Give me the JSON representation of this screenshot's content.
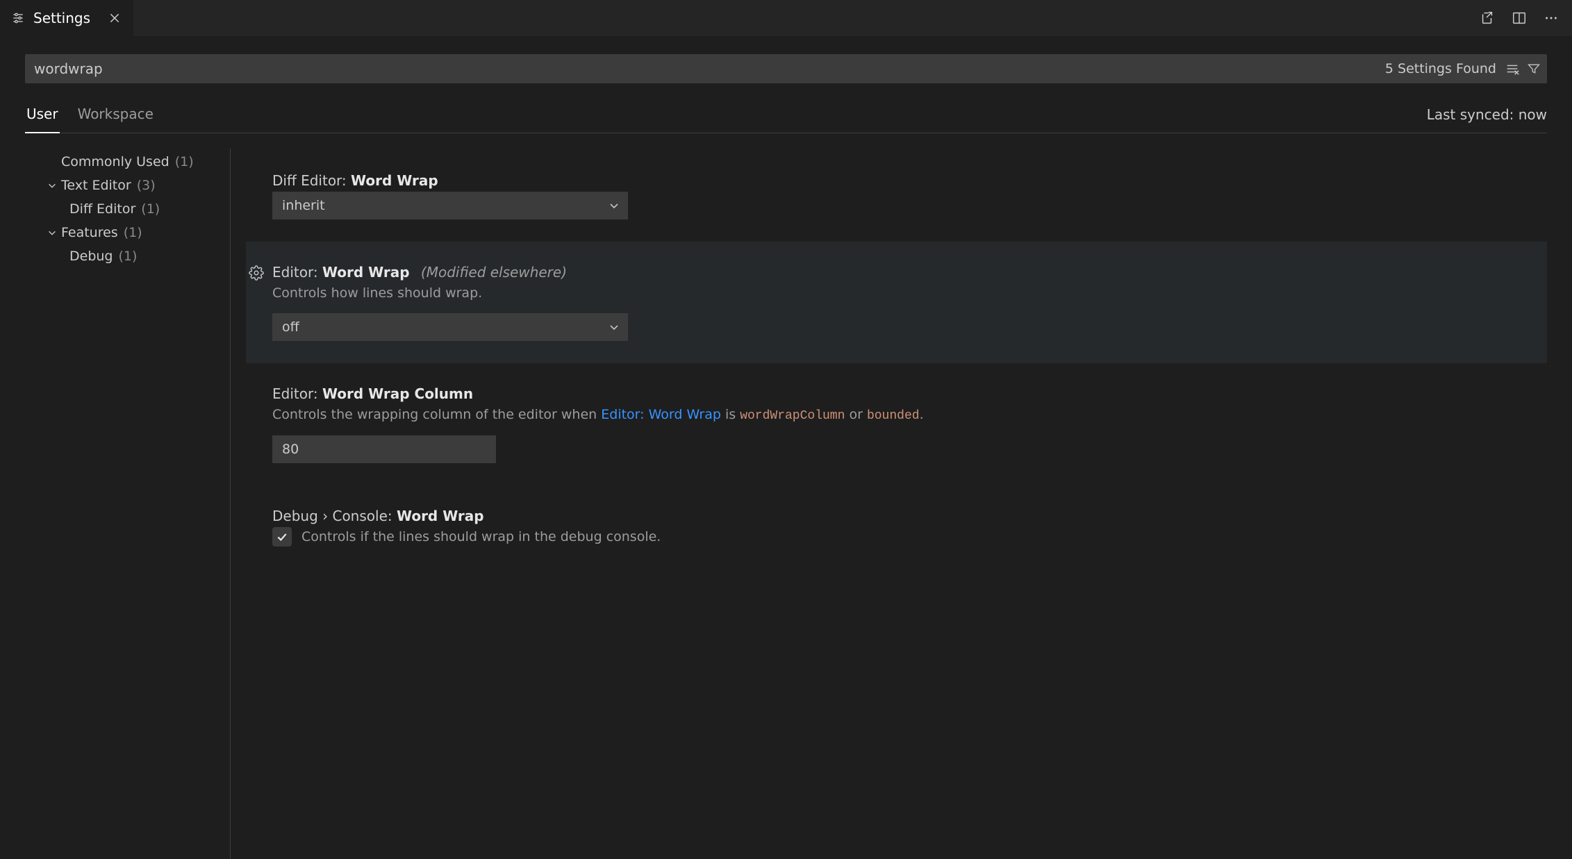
{
  "tab": {
    "title": "Settings"
  },
  "search": {
    "value": "wordwrap",
    "found_text": "5 Settings Found"
  },
  "scope": {
    "user": "User",
    "workspace": "Workspace",
    "synced": "Last synced: now"
  },
  "sidebar": {
    "commonly_used": {
      "label": "Commonly Used",
      "count": "(1)"
    },
    "text_editor": {
      "label": "Text Editor",
      "count": "(3)"
    },
    "diff_editor": {
      "label": "Diff Editor",
      "count": "(1)"
    },
    "features": {
      "label": "Features",
      "count": "(1)"
    },
    "debug": {
      "label": "Debug",
      "count": "(1)"
    }
  },
  "settings": {
    "diff_ww": {
      "scope": "Diff Editor:",
      "name": "Word Wrap",
      "value": "inherit"
    },
    "editor_ww": {
      "scope": "Editor:",
      "name": "Word Wrap",
      "badge": "(Modified elsewhere)",
      "desc": "Controls how lines should wrap.",
      "value": "off"
    },
    "editor_wwc": {
      "scope": "Editor:",
      "name": "Word Wrap Column",
      "desc_prefix": "Controls the wrapping column of the editor when ",
      "desc_link": "Editor: Word Wrap",
      "desc_mid1": " is ",
      "desc_code1": "wordWrapColumn",
      "desc_mid2": " or ",
      "desc_code2": "bounded",
      "desc_suffix": ".",
      "value": "80"
    },
    "debug_ww": {
      "scope": "Debug › Console:",
      "name": "Word Wrap",
      "desc": "Controls if the lines should wrap in the debug console."
    }
  }
}
